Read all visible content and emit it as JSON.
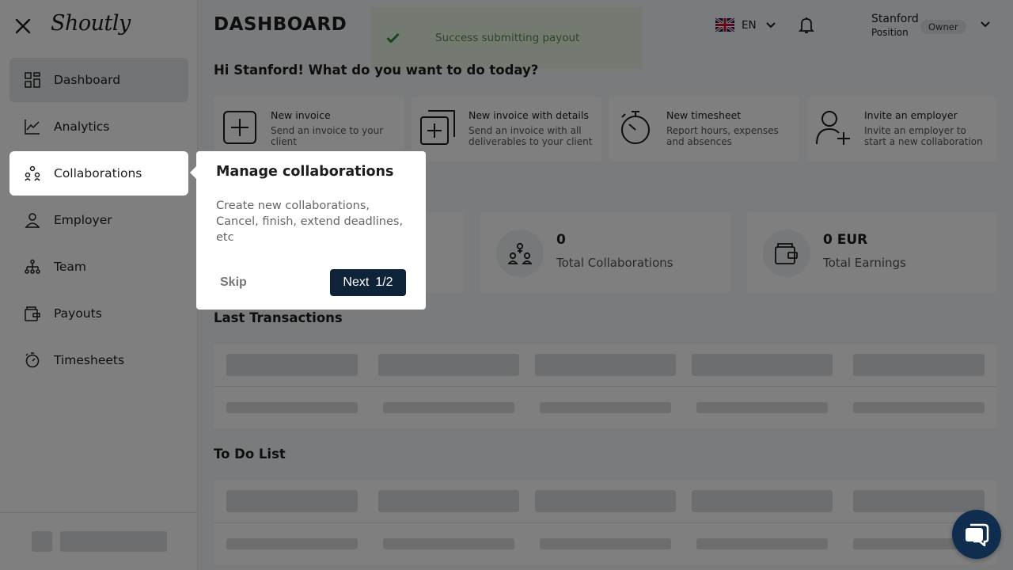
{
  "app": {
    "logo": "Shoutly"
  },
  "sidebar": {
    "items": [
      {
        "label": "Dashboard",
        "icon": "dashboard-grid-icon"
      },
      {
        "label": "Analytics",
        "icon": "line-chart-icon"
      },
      {
        "label": "Collaborations",
        "icon": "people-network-icon"
      },
      {
        "label": "Employer",
        "icon": "user-icon"
      },
      {
        "label": "Team",
        "icon": "team-icon"
      },
      {
        "label": "Payouts",
        "icon": "wallet-icon"
      },
      {
        "label": "Timesheets",
        "icon": "stopwatch-icon"
      }
    ]
  },
  "header": {
    "title": "DASHBOARD",
    "language": "EN",
    "user": {
      "name": "Stanford",
      "position": "Position",
      "role": "Owner"
    }
  },
  "toast": {
    "message": "Success submitting payout"
  },
  "greeting": "Hi Stanford! What do you want to do today?",
  "actions": [
    {
      "title": "New invoice",
      "desc": "Send an invoice to your client",
      "icon": "plus-square-icon"
    },
    {
      "title": "New invoice with details",
      "desc": "Send an invoice with all deliverables to your client",
      "icon": "plus-stacked-square-icon"
    },
    {
      "title": "New timesheet",
      "desc": "Report hours, expenses and absences",
      "icon": "stopwatch-icon"
    },
    {
      "title": "Invite an employer",
      "desc": "Invite an employer to start a new collaboration",
      "icon": "add-user-icon"
    }
  ],
  "stats": [
    {
      "value": "0",
      "label": "Total Collaborations",
      "icon": "people-network-icon"
    },
    {
      "value": "0 EUR",
      "label": "Total Earnings",
      "icon": "wallet-icon"
    }
  ],
  "sections": {
    "transactions": "Last Transactions",
    "todo": "To Do List"
  },
  "tour": {
    "title": "Manage collaborations",
    "body": "Create new collaborations, Cancel, finish, extend deadlines, etc",
    "skip": "Skip",
    "next": "Next",
    "step": "1/2"
  },
  "colors": {
    "primary": "#0e2337",
    "chat": "#0e2d4f",
    "toast_bg": "#e8f3e4",
    "toast_text": "#5b8a4b"
  }
}
